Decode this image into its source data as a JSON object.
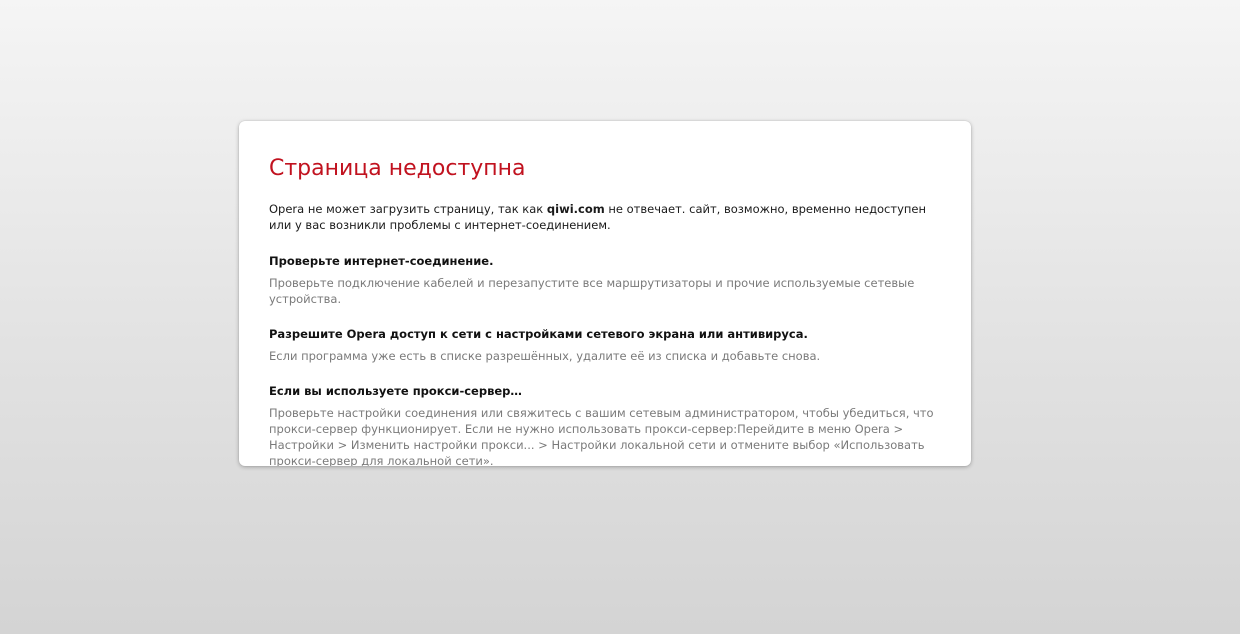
{
  "error": {
    "title": "Страница недоступна",
    "intro_prefix": "Opera не может загрузить страницу, так как ",
    "host": "qiwi.com",
    "intro_suffix": " не отвечает. сайт, возможно, временно недоступен или у вас возникли проблемы с интернет-соединением.",
    "sections": [
      {
        "heading": "Проверьте интернет-соединение.",
        "text": "Проверьте подключение кабелей и перезапустите все маршрутизаторы и прочие используемые сетевые устройства."
      },
      {
        "heading": "Разрешите Opera доступ к сети с настройками сетевого экрана или антивируса.",
        "text": "Если программа уже есть в списке разрешённых, удалите её из списка и добавьте снова."
      },
      {
        "heading": "Если вы используете прокси-сервер…",
        "text": "Проверьте настройки соединения или свяжитесь с вашим сетевым администратором, чтобы убедиться, что прокси-сервер функционирует. Если не нужно использовать прокси-сервер:Перейдите в меню Opera > Настройки > Изменить настройки прокси... > Настройки локальной сети и отмените выбор «Использовать прокси-сервер для локальной сети»."
      }
    ]
  },
  "colors": {
    "title": "#c1121f",
    "body_text": "#1a1a1a",
    "muted_text": "#7a7a7a",
    "card_background": "#ffffff"
  }
}
